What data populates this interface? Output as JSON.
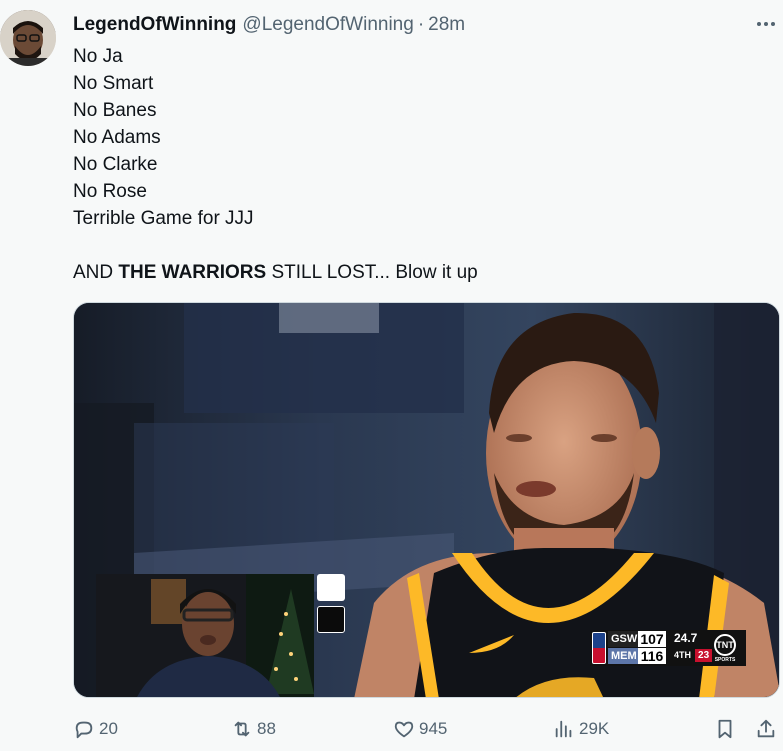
{
  "tweet": {
    "display_name": "LegendOfWinning",
    "handle": "@LegendOfWinning",
    "separator": "·",
    "time": "28m",
    "lines": [
      "No Ja",
      "No Smart",
      "No Banes",
      "No Adams",
      "No Clarke",
      "No Rose",
      "Terrible Game for JJJ"
    ],
    "final_line": {
      "prefix": "AND ",
      "bold": "THE WARRIORS",
      "suffix": " STILL LOST... Blow it up"
    }
  },
  "scorebug": {
    "team1": "GSW",
    "score1": "107",
    "team2": "MEM",
    "score2": "116",
    "shot_clock": "24.7",
    "quarter": "4TH",
    "game_clock": "23",
    "network": "TNT",
    "network_sub": "SPORTS"
  },
  "actions": {
    "replies": "20",
    "retweets": "88",
    "likes": "945",
    "views": "29K"
  },
  "icons": {
    "reply": "reply-icon",
    "retweet": "retweet-icon",
    "like": "heart-icon",
    "views": "views-icon",
    "bookmark": "bookmark-icon",
    "share": "share-icon",
    "more": "more-icon"
  },
  "colors": {
    "text_primary": "#0f1419",
    "text_secondary": "#536471",
    "background": "#f7f9f9",
    "jersey_gold": "#fdb927"
  }
}
